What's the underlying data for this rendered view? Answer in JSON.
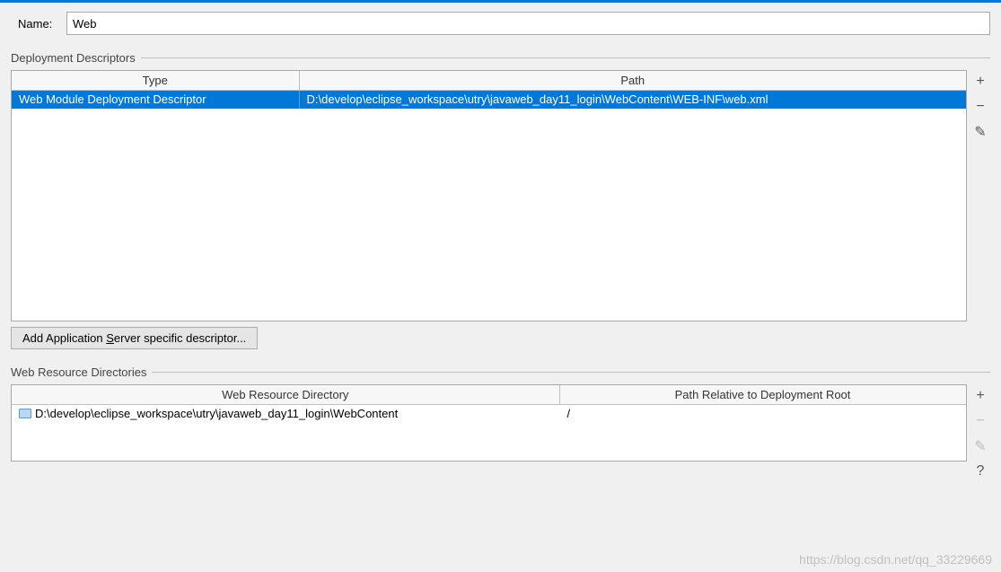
{
  "name": {
    "label": "Name:",
    "value": "Web"
  },
  "deploymentDescriptors": {
    "title": "Deployment Descriptors",
    "headers": {
      "type": "Type",
      "path": "Path"
    },
    "rows": [
      {
        "type": "Web Module Deployment Descriptor",
        "path": "D:\\develop\\eclipse_workspace\\utry\\javaweb_day11_login\\WebContent\\WEB-INF\\web.xml"
      }
    ],
    "addButton": {
      "before": "Add Application ",
      "hotkey": "S",
      "after": "erver specific descriptor..."
    }
  },
  "webResourceDirectories": {
    "title": "Web Resource Directories",
    "headers": {
      "dir": "Web Resource Directory",
      "relPath": "Path Relative to Deployment Root"
    },
    "rows": [
      {
        "dir": "D:\\develop\\eclipse_workspace\\utry\\javaweb_day11_login\\WebContent",
        "relPath": "/"
      }
    ]
  },
  "icons": {
    "add": "+",
    "remove": "−",
    "edit": "✎",
    "help": "?"
  },
  "watermark": "https://blog.csdn.net/qq_33229669"
}
